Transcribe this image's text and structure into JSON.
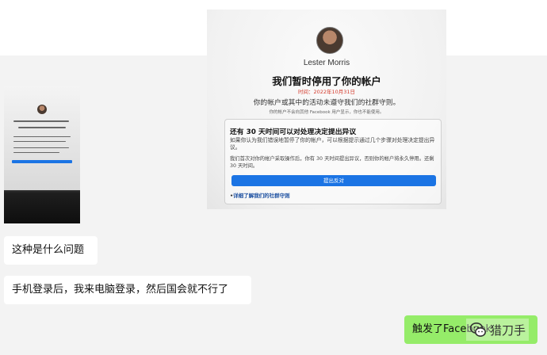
{
  "photo": {
    "name": "Lester Morris",
    "heading": "我们暂时停用了你的帐户",
    "date": "时间：2022年10月31日",
    "subtitle": "你的帐户或其中的活动未遵守我们的社群守则。",
    "subtitle_small": "你的帐户不会向其他 Facebook 用户显示，你也不能使用。",
    "appeal_title": "还有 30 天时间可以对处理决定提出异议",
    "appeal_p1": "如果你认为我们错误地暂停了你的帐户，可以根据提示通过几个步骤对处理决定提出异议。",
    "appeal_p2": "我们首次对你的帐户采取操作后，你有 30 天时间提出异议，否则你的帐户将永久停用。还剩 30 天时间。",
    "appeal_button": "提出反对",
    "learn_more": "详细了解我们的社群守则"
  },
  "messages": [
    {
      "text": "这种是什么问题"
    },
    {
      "text": "手机登录后，我来电脑登录，然后国会就不行了"
    },
    {
      "text": "触发了Facebook"
    }
  ],
  "watermark": {
    "text": "猎刀手"
  },
  "colors": {
    "chat_bg": "#f3f3f3",
    "own_bubble": "#95ec69",
    "fb_blue": "#1b74e4",
    "date_red": "#d33a2c"
  }
}
